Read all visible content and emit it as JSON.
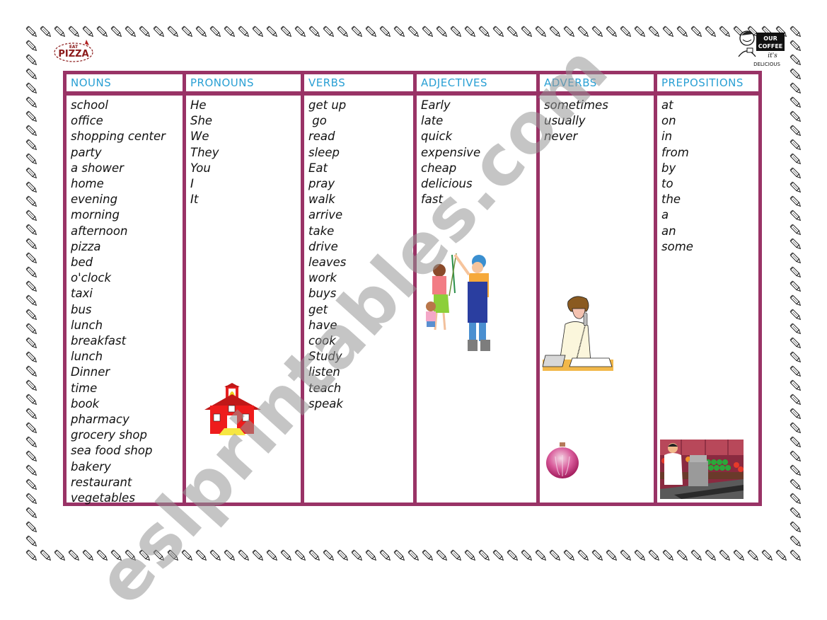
{
  "document": {
    "type": "vocabulary worksheet",
    "border_color": "#993366",
    "header_text_color": "#2aa0d4",
    "watermark": "eslprintables.com"
  },
  "logos": {
    "pizza": {
      "top_text": "EAT",
      "main_text": "PIZZA"
    },
    "coffee": {
      "line1": "OUR",
      "line2": "COFFEE",
      "line3": "it's",
      "line4": "DELICIOUS"
    }
  },
  "columns": [
    {
      "header": "NOUNS",
      "items": [
        "school",
        "office",
        "shopping center",
        "party",
        "a shower",
        "home",
        "evening",
        "morning",
        "afternoon",
        "pizza",
        "bed",
        "o'clock",
        "taxi",
        "bus",
        "lunch",
        "breakfast",
        "lunch",
        "Dinner",
        "time",
        "book",
        "pharmacy",
        "grocery shop",
        "sea food shop",
        "bakery",
        "restaurant",
        "vegetables"
      ]
    },
    {
      "header": "PRONOUNS",
      "items": [
        "He",
        "She",
        "We",
        "They",
        "You",
        "I",
        "It"
      ],
      "illustration": "schoolhouse-icon"
    },
    {
      "header": "VERBS",
      "items": [
        "get up",
        " go",
        "read",
        "sleep",
        "Eat",
        "pray",
        "walk",
        "arrive",
        "take",
        "drive",
        "leaves",
        "work",
        "buys",
        "get",
        "have",
        "cook",
        "Study",
        "listen",
        "teach",
        "speak"
      ]
    },
    {
      "header": "ADJECTIVES",
      "items": [
        "Early",
        "late",
        "quick",
        "expensive",
        "cheap",
        "delicious",
        "fast"
      ],
      "illustration": "family-shopping-illustration"
    },
    {
      "header": "ADVERBS",
      "items": [
        "sometimes",
        "usually",
        "never"
      ],
      "illustration": [
        "man-on-phone-illustration",
        "onion-icon"
      ]
    },
    {
      "header": "PREPOSITIONS",
      "items": [
        "at",
        "on",
        "in",
        "from",
        "by",
        "to",
        "the",
        "a",
        "an",
        "some"
      ],
      "illustration": "grocery-cashier-illustration"
    }
  ]
}
